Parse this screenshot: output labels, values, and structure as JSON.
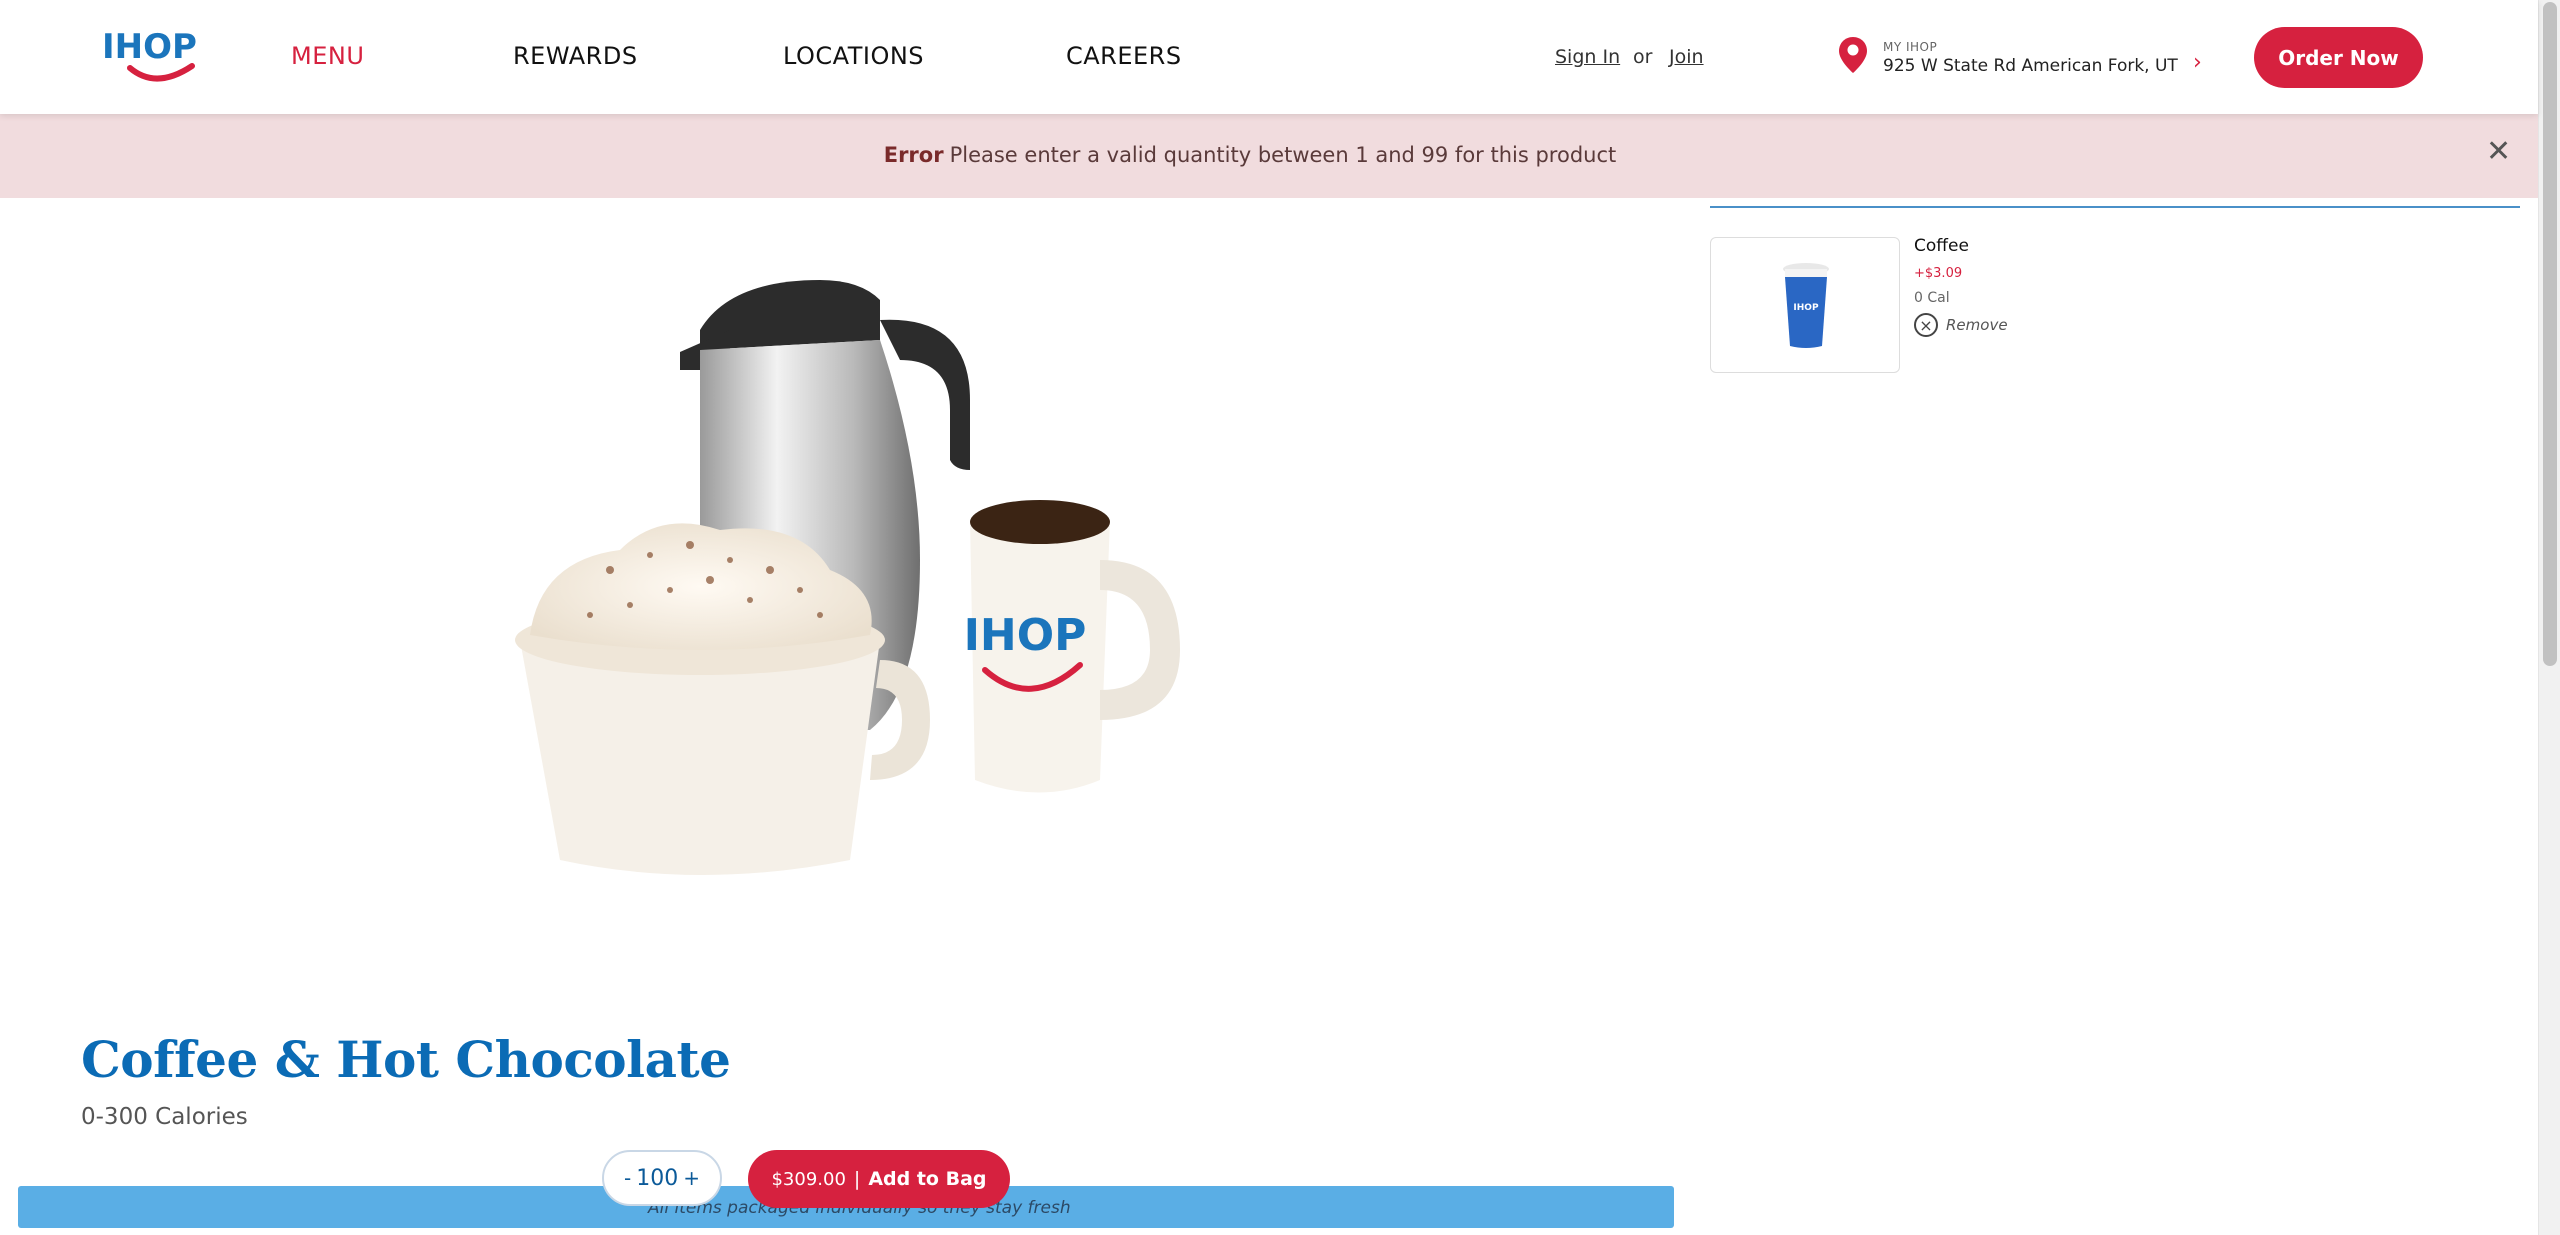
{
  "header": {
    "logo_text": "IHOP",
    "nav": [
      {
        "label": "MENU",
        "active": true
      },
      {
        "label": "REWARDS"
      },
      {
        "label": "LOCATIONS"
      },
      {
        "label": "CAREERS"
      }
    ],
    "sign_in": "Sign In",
    "or": "or",
    "join": "Join",
    "my_ihop_label": "MY IHOP",
    "address": "925 W State Rd American Fork, UT",
    "order_now": "Order Now"
  },
  "error": {
    "title": "Error",
    "message": "Please enter a valid quantity between 1 and 99 for this product",
    "close_icon": "close-icon"
  },
  "bag": {
    "item_name": "Coffee",
    "item_price": "+$3.09",
    "item_cal": "0 Cal",
    "remove": "Remove"
  },
  "product": {
    "title": "Coffee & Hot Chocolate",
    "calories": "0-300 Calories",
    "info_bar_text": "All items packaged individually so they stay fresh",
    "quantity": "100",
    "minus": "-",
    "plus": "+",
    "add_price": "$309.00",
    "add_sep": "|",
    "add_label": "Add to Bag"
  },
  "colors": {
    "brand_red": "#d6213f",
    "brand_blue": "#0b6bb5",
    "error_bg": "#f1dcde",
    "info_bar": "#5aaee5"
  }
}
